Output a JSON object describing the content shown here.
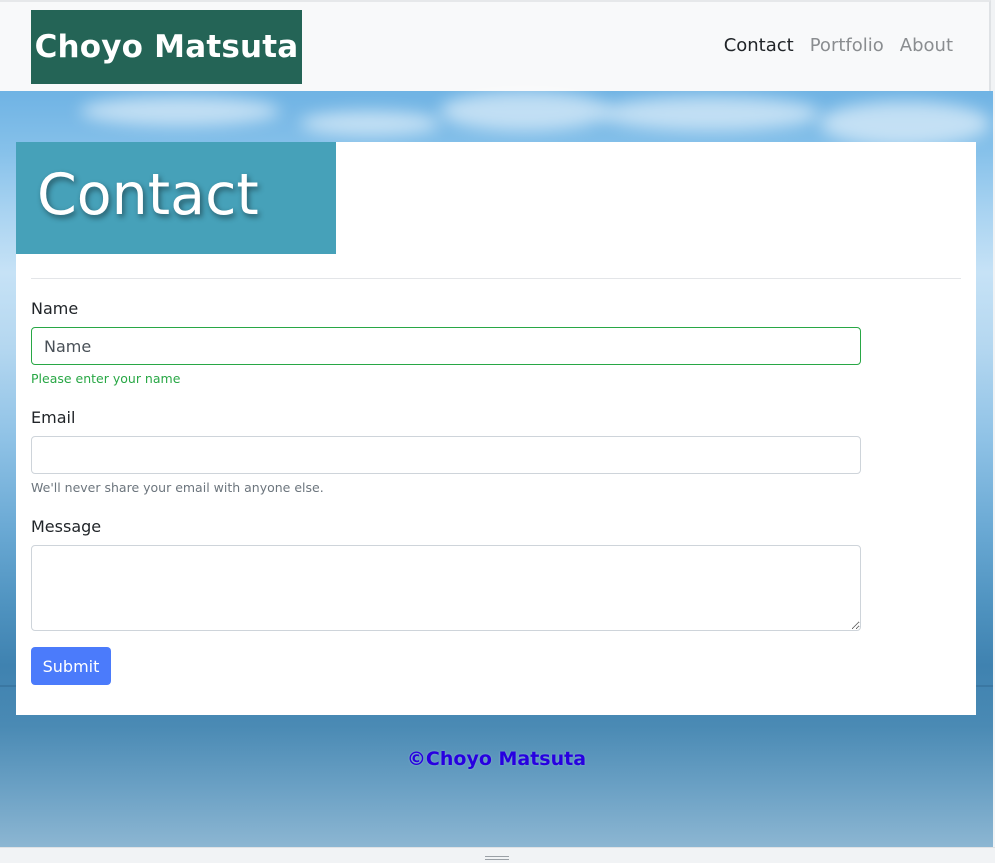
{
  "navbar": {
    "brand": "Choyo Matsuta",
    "links": [
      {
        "label": "Contact",
        "active": true
      },
      {
        "label": "Portfolio",
        "active": false
      },
      {
        "label": "About",
        "active": false
      }
    ]
  },
  "hero": {
    "title": "Contact"
  },
  "form": {
    "name": {
      "label": "Name",
      "placeholder": "Name",
      "value": "",
      "help": "Please enter your name",
      "state_color": "#28a745"
    },
    "email": {
      "label": "Email",
      "placeholder": "",
      "value": "",
      "help": "We'll never share your email with anyone else."
    },
    "message": {
      "label": "Message",
      "placeholder": "",
      "value": ""
    },
    "submit_label": "Submit"
  },
  "footer": {
    "text": "©Choyo Matsuta"
  },
  "colors": {
    "brand_bg": "#246456",
    "hero_bg": "#46a1b9",
    "submit_bg": "#4b7bfb",
    "footer_text": "#2700e0"
  }
}
